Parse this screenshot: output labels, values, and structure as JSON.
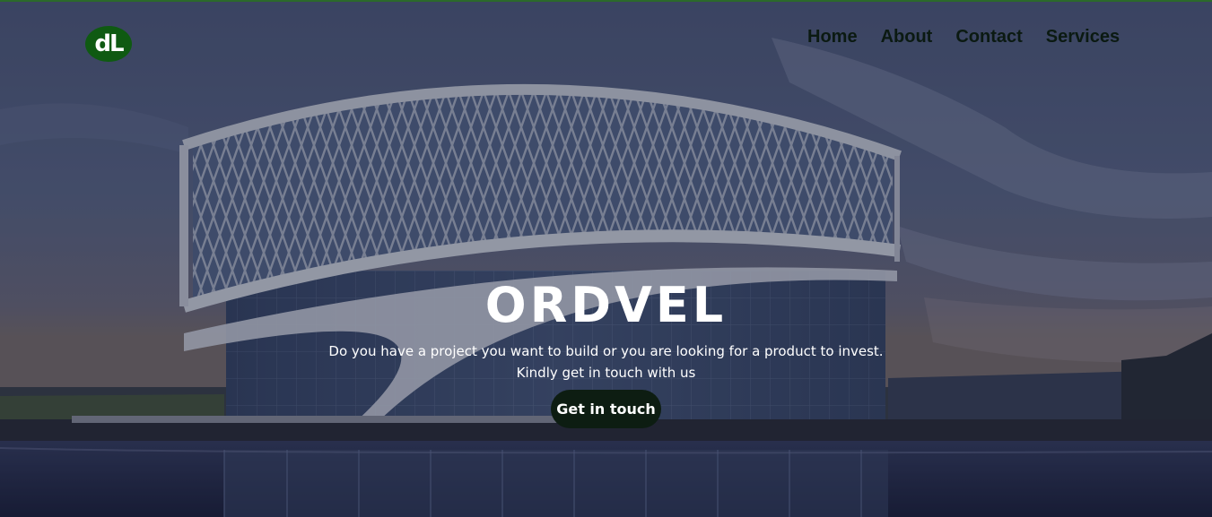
{
  "brand": {
    "logo_text": "dL"
  },
  "nav": {
    "items": [
      {
        "label": "Home"
      },
      {
        "label": "About"
      },
      {
        "label": "Contact"
      },
      {
        "label": "Services"
      }
    ]
  },
  "hero": {
    "title": "ORDVEL",
    "line1": "Do you have a project you want to build or you are looking for a product to invest.",
    "line2": "Kindly get in touch with us",
    "cta_label": "Get in touch"
  },
  "colors": {
    "accent_green": "#0f5a12",
    "cta_bg": "#0d1d12",
    "top_border": "#2b6a2b"
  }
}
